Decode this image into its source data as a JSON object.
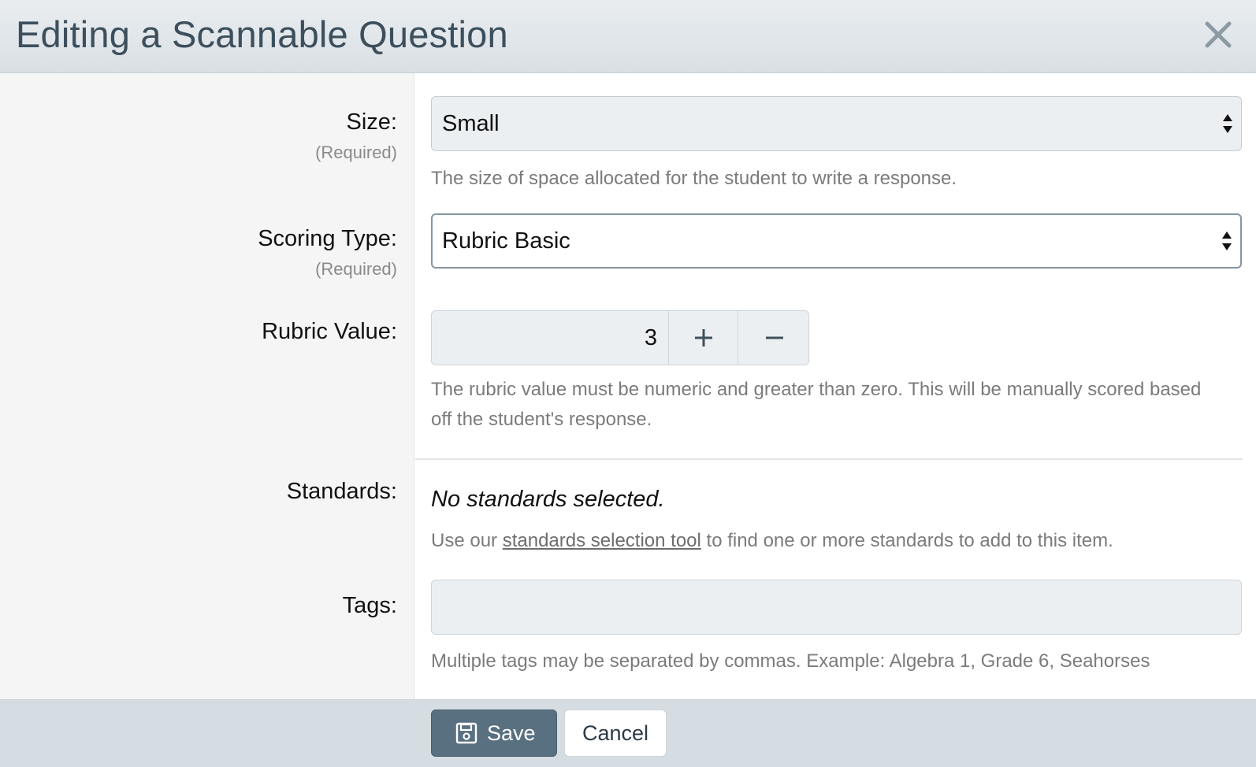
{
  "dialog": {
    "title": "Editing a Scannable Question",
    "close_icon": "close-icon"
  },
  "form": {
    "size": {
      "label": "Size:",
      "required": "(Required)",
      "selected": "Small",
      "help": "The size of space allocated for the student to write a response."
    },
    "scoring_type": {
      "label": "Scoring Type:",
      "required": "(Required)",
      "selected": "Rubric Basic"
    },
    "rubric_value": {
      "label": "Rubric Value:",
      "value": "3",
      "help": "The rubric value must be numeric and greater than zero. This will be manually scored based off the student's response."
    },
    "standards": {
      "label": "Standards:",
      "empty_text": "No standards selected.",
      "help_prefix": "Use our ",
      "help_link": "standards selection tool",
      "help_suffix": " to find one or more standards to add to this item."
    },
    "tags": {
      "label": "Tags:",
      "value": "",
      "help": "Multiple tags may be separated by commas. Example: Algebra 1, Grade 6, Seahorses"
    }
  },
  "footer": {
    "save_label": "Save",
    "cancel_label": "Cancel"
  },
  "colors": {
    "header_title": "#3d4f5c",
    "primary_button": "#587080",
    "footer_bg": "#d5dde2"
  }
}
